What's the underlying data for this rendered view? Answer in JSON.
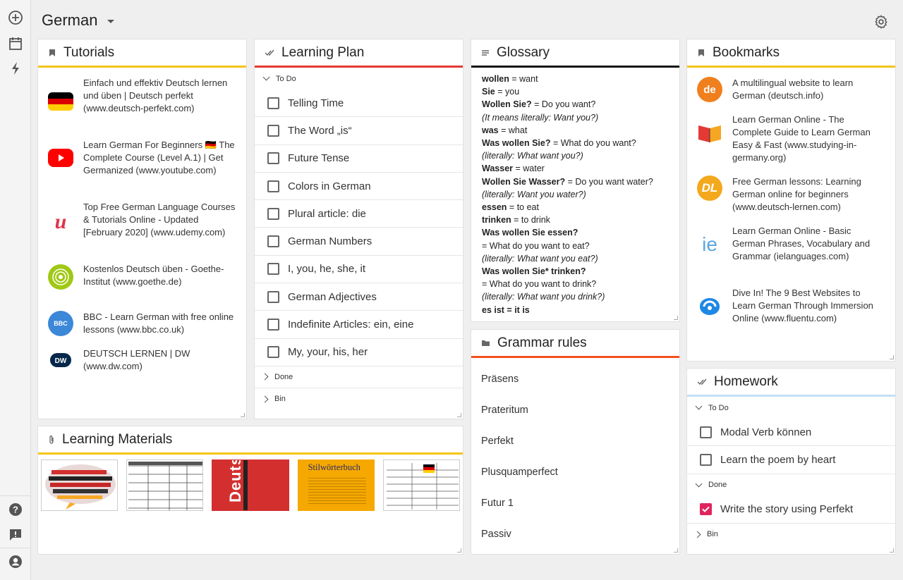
{
  "header": {
    "title": "German"
  },
  "tutorials": {
    "title": "Tutorials",
    "items": [
      {
        "text": "Einfach und effektiv Deutsch lernen und üben | Deutsch perfekt (www.deutsch-perfekt.com)"
      },
      {
        "text": "Learn German For Beginners 🇩🇪 The Complete Course (Level A.1) | Get Germanized (www.youtube.com)"
      },
      {
        "text": "Top Free German Language Courses & Tutorials Online - Updated [February 2020] (www.udemy.com)"
      },
      {
        "text": "Kostenlos Deutsch üben - Goethe-Institut (www.goethe.de)"
      },
      {
        "text": "BBC - Learn German with free online lessons (www.bbc.co.uk)"
      },
      {
        "text": "DEUTSCH LERNEN | DW (www.dw.com)"
      }
    ]
  },
  "learning_plan": {
    "title": "Learning Plan",
    "todo_label": "To Do",
    "tasks": [
      "Telling Time",
      "The Word „is“",
      "Future Tense",
      "Colors in German",
      "Plural article: die",
      "German Numbers",
      "I, you, he, she, it",
      "German Adjectives",
      "Indefinite Articles: ein, eine",
      "My, your, his, her"
    ],
    "done_label": "Done",
    "bin_label": "Bin"
  },
  "glossary": {
    "title": "Glossary",
    "lines": [
      {
        "bold": "wollen",
        "rest": " = want"
      },
      {
        "bold": "Sie",
        "rest": " = you"
      },
      {
        "bold": "Wollen Sie?",
        "rest": " = Do you want?"
      },
      {
        "italic": "(It means literally: Want you?)"
      },
      {
        "bold": "was",
        "rest": " = what"
      },
      {
        "bold": "Was wollen Sie?",
        "rest": " = What do you want?"
      },
      {
        "italic": "(literally: What want you?)"
      },
      {
        "bold": "Wasser",
        "rest": " = water"
      },
      {
        "bold": "Wollen Sie Wasser?",
        "rest": " = Do you want water?"
      },
      {
        "italic": "(literally: Want you water?)"
      },
      {
        "bold": "essen",
        "rest": " = to eat"
      },
      {
        "bold": "trinken",
        "rest": " = to drink"
      },
      {
        "bold": "Was wollen Sie essen?",
        "rest": ""
      },
      {
        "plain": "= What do you want to eat?"
      },
      {
        "italic": "(literally: What want you eat?)"
      },
      {
        "bold": "Was wollen Sie* trinken?",
        "rest": ""
      },
      {
        "plain": "= What do you want to drink?"
      },
      {
        "italic": "(literally: What want you drink?)"
      },
      {
        "bold": "es ist = it is",
        "rest": ""
      }
    ]
  },
  "grammar": {
    "title": "Grammar rules",
    "items": [
      "Präsens",
      "Prateritum",
      "Perfekt",
      "Plusquamperfect",
      "Futur 1",
      "Passiv"
    ]
  },
  "bookmarks": {
    "title": "Bookmarks",
    "items": [
      {
        "text": "A multilingual website to learn German (deutsch.info)",
        "icon_text": "de"
      },
      {
        "text": "Learn German Online - The Complete Guide to Learn German Easy & Fast (www.studying-in-germany.org)"
      },
      {
        "text": "Free German lessons: Learning German online for beginners (www.deutsch-lernen.com)",
        "icon_text": "DL"
      },
      {
        "text": "Learn German Online - Basic German Phrases, Vocabulary and Grammar (ielanguages.com)",
        "icon_text": "ie"
      },
      {
        "text": "Dive In! The 9 Best Websites to Learn German Through Immersion Online (www.fluentu.com)"
      }
    ]
  },
  "homework": {
    "title": "Homework",
    "todo_label": "To Do",
    "todo": [
      "Modal Verb können",
      "Learn the poem by heart"
    ],
    "done_label": "Done",
    "done": [
      "Write the story using Perfekt"
    ],
    "bin_label": "Bin"
  },
  "materials": {
    "title": "Learning Materials",
    "thumb3_text": "Deutsch",
    "thumb4_text": "Stilwörterbuch"
  },
  "colors": {
    "yellow": "#f5c518",
    "red": "#e53935",
    "black": "#111111",
    "orange": "#f4511e",
    "lightblue": "#c5dff3"
  }
}
